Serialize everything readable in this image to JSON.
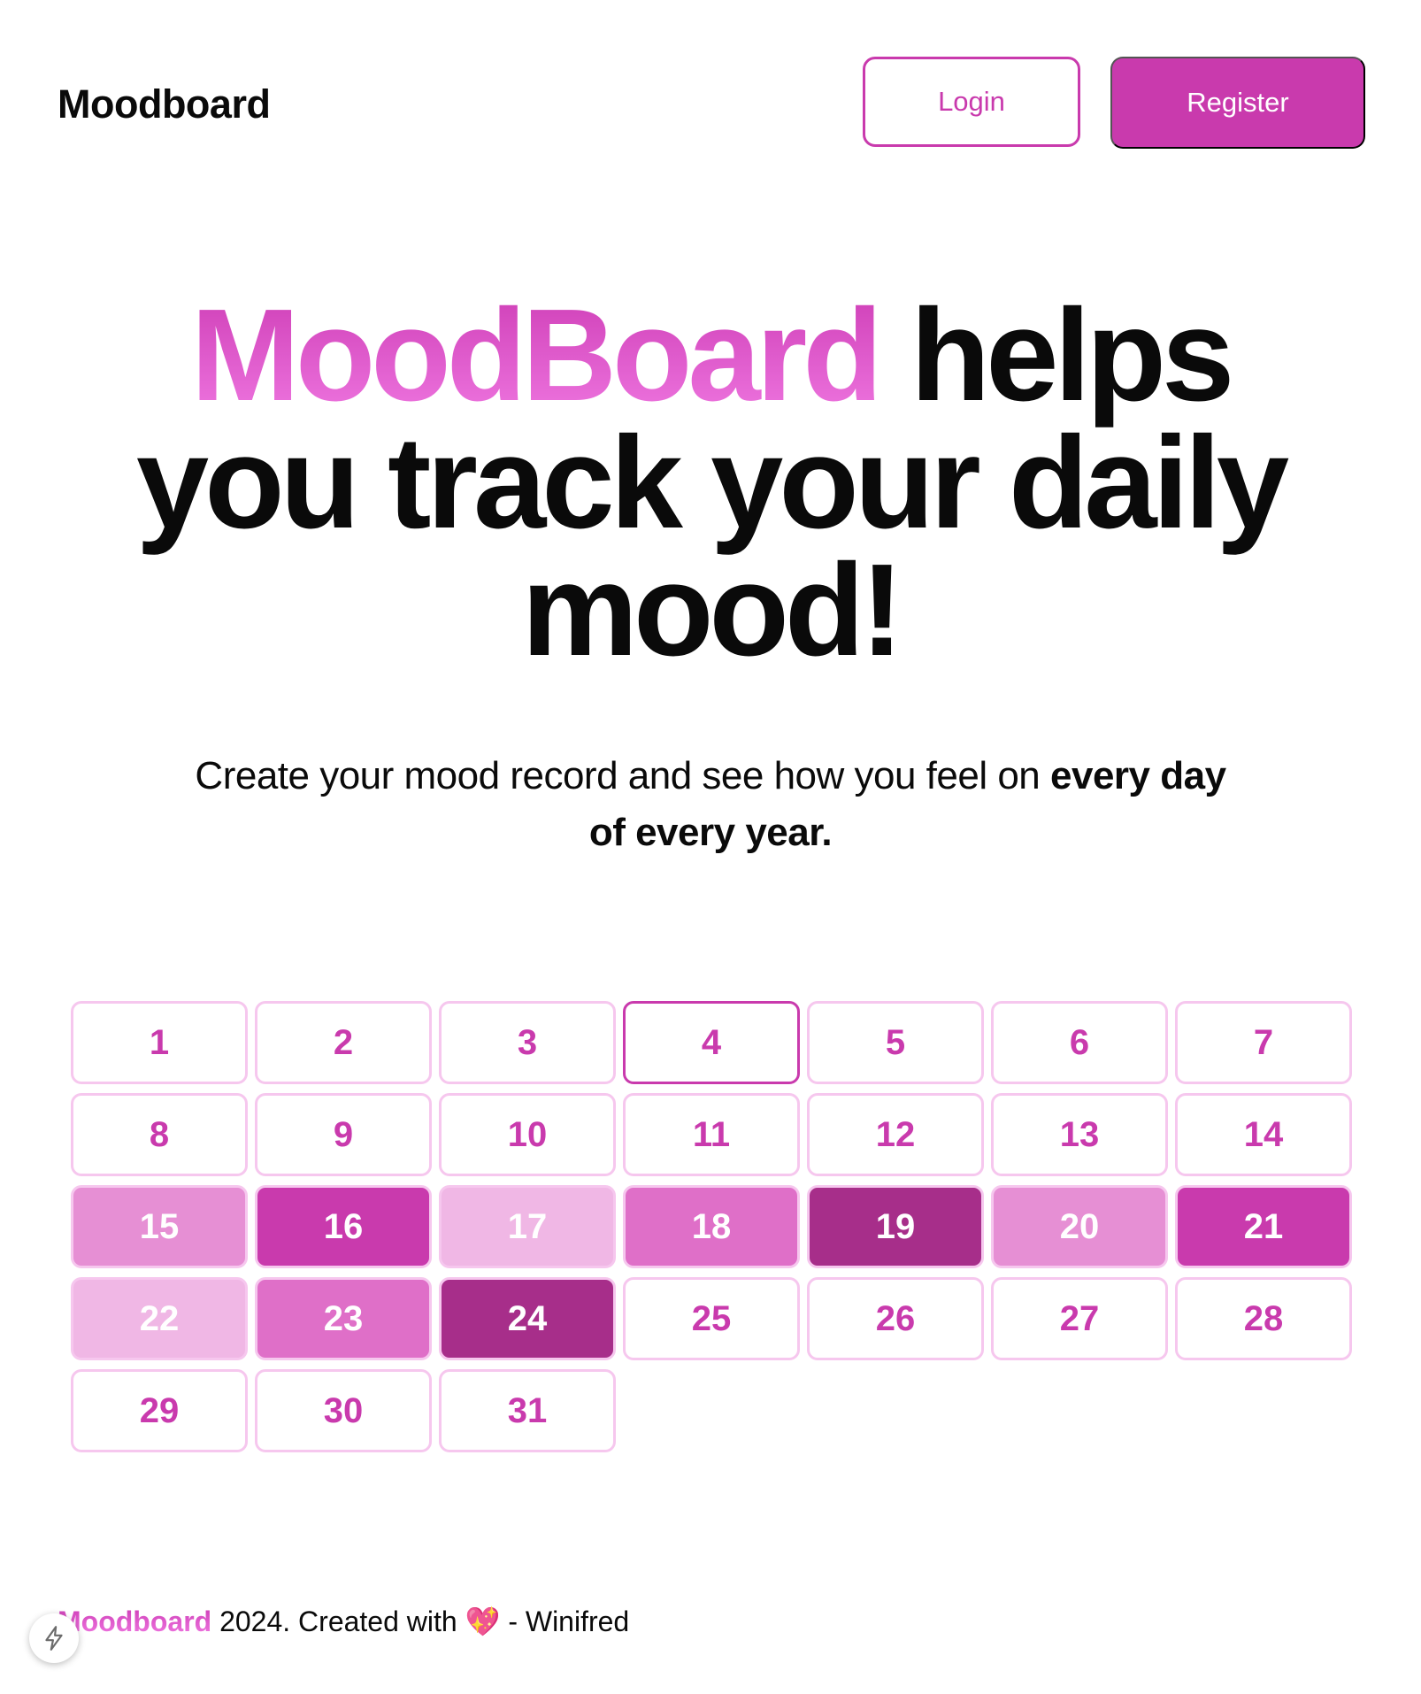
{
  "header": {
    "logo": "Moodboard",
    "login_label": "Login",
    "register_label": "Register"
  },
  "hero": {
    "brand": "MoodBoard",
    "rest": " helps you track your daily mood!"
  },
  "subtitle": {
    "text": "Create your mood record and see how you feel on ",
    "bold": "every day of every year."
  },
  "calendar": {
    "today": 4,
    "days": [
      {
        "label": "1",
        "bg": "#ffffff",
        "fg": "#c93aad"
      },
      {
        "label": "2",
        "bg": "#ffffff",
        "fg": "#c93aad"
      },
      {
        "label": "3",
        "bg": "#ffffff",
        "fg": "#c93aad"
      },
      {
        "label": "4",
        "bg": "#ffffff",
        "fg": "#c93aad"
      },
      {
        "label": "5",
        "bg": "#ffffff",
        "fg": "#c93aad"
      },
      {
        "label": "6",
        "bg": "#ffffff",
        "fg": "#c93aad"
      },
      {
        "label": "7",
        "bg": "#ffffff",
        "fg": "#c93aad"
      },
      {
        "label": "8",
        "bg": "#ffffff",
        "fg": "#c93aad"
      },
      {
        "label": "9",
        "bg": "#ffffff",
        "fg": "#c93aad"
      },
      {
        "label": "10",
        "bg": "#ffffff",
        "fg": "#c93aad"
      },
      {
        "label": "11",
        "bg": "#ffffff",
        "fg": "#c93aad"
      },
      {
        "label": "12",
        "bg": "#ffffff",
        "fg": "#c93aad"
      },
      {
        "label": "13",
        "bg": "#ffffff",
        "fg": "#c93aad"
      },
      {
        "label": "14",
        "bg": "#ffffff",
        "fg": "#c93aad"
      },
      {
        "label": "15",
        "bg": "#e68fd4",
        "fg": "#ffffff"
      },
      {
        "label": "16",
        "bg": "#c93aad",
        "fg": "#ffffff"
      },
      {
        "label": "17",
        "bg": "#f0b7e5",
        "fg": "#ffffff"
      },
      {
        "label": "18",
        "bg": "#df6fc8",
        "fg": "#ffffff"
      },
      {
        "label": "19",
        "bg": "#a72e8a",
        "fg": "#ffffff"
      },
      {
        "label": "20",
        "bg": "#e68fd4",
        "fg": "#ffffff"
      },
      {
        "label": "21",
        "bg": "#c93aad",
        "fg": "#ffffff"
      },
      {
        "label": "22",
        "bg": "#f0b7e5",
        "fg": "#ffffff"
      },
      {
        "label": "23",
        "bg": "#df6fc8",
        "fg": "#ffffff"
      },
      {
        "label": "24",
        "bg": "#a72e8a",
        "fg": "#ffffff"
      },
      {
        "label": "25",
        "bg": "#ffffff",
        "fg": "#c93aad"
      },
      {
        "label": "26",
        "bg": "#ffffff",
        "fg": "#c93aad"
      },
      {
        "label": "27",
        "bg": "#ffffff",
        "fg": "#c93aad"
      },
      {
        "label": "28",
        "bg": "#ffffff",
        "fg": "#c93aad"
      },
      {
        "label": "29",
        "bg": "#ffffff",
        "fg": "#c93aad"
      },
      {
        "label": "30",
        "bg": "#ffffff",
        "fg": "#c93aad"
      },
      {
        "label": "31",
        "bg": "#ffffff",
        "fg": "#c93aad"
      }
    ]
  },
  "footer": {
    "brand": "Moodboard",
    "text": " 2024. Created with ",
    "heart": "💖",
    "author": " - Winifred"
  },
  "icons": {
    "dev_badge": "lightning-bolt-icon",
    "heart": "sparkling-heart-icon"
  },
  "colors": {
    "accent": "#c93aad",
    "accent_light": "#f6c7ee"
  }
}
